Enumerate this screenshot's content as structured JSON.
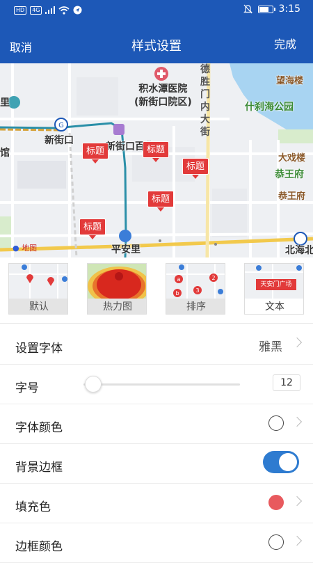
{
  "status_bar": {
    "left_chips": [
      "HD",
      "4G"
    ],
    "time": "3:15"
  },
  "nav": {
    "cancel_label": "取消",
    "title": "样式设置",
    "done_label": "完成"
  },
  "map": {
    "hospital": "积水潭医院",
    "hospital_sub": "(新街口院区)",
    "street_vertical": "德胜门内大街",
    "labels": [
      "望海楼",
      "什刹海公园",
      "新街口",
      "新街口百货",
      "大戏楼",
      "恭王府",
      "恭王府",
      "平安里",
      "北海北",
      "馆",
      "里"
    ],
    "marker_label": "标题",
    "logo_text": "地图"
  },
  "styles": [
    {
      "label": "默认",
      "selected": false
    },
    {
      "label": "热力图",
      "selected": false
    },
    {
      "label": "排序",
      "selected": false
    },
    {
      "label": "文本",
      "selected": true,
      "sample_text": "天安门广场"
    }
  ],
  "settings": {
    "font": {
      "label": "设置字体",
      "value": "雅黑"
    },
    "font_size": {
      "label": "字号",
      "value": "12",
      "level": 0.0
    },
    "font_color": {
      "label": "字体颜色",
      "color": "#ffffff"
    },
    "background_border": {
      "label": "背景边框",
      "on": true
    },
    "fill_color": {
      "label": "填充色",
      "color": "#e85a5e"
    },
    "border_color": {
      "label": "边框颜色",
      "color": "#ffffff"
    }
  },
  "colors": {
    "header": "#1d58b7",
    "accent": "#2e7bd0",
    "marker": "#e23a3a"
  }
}
